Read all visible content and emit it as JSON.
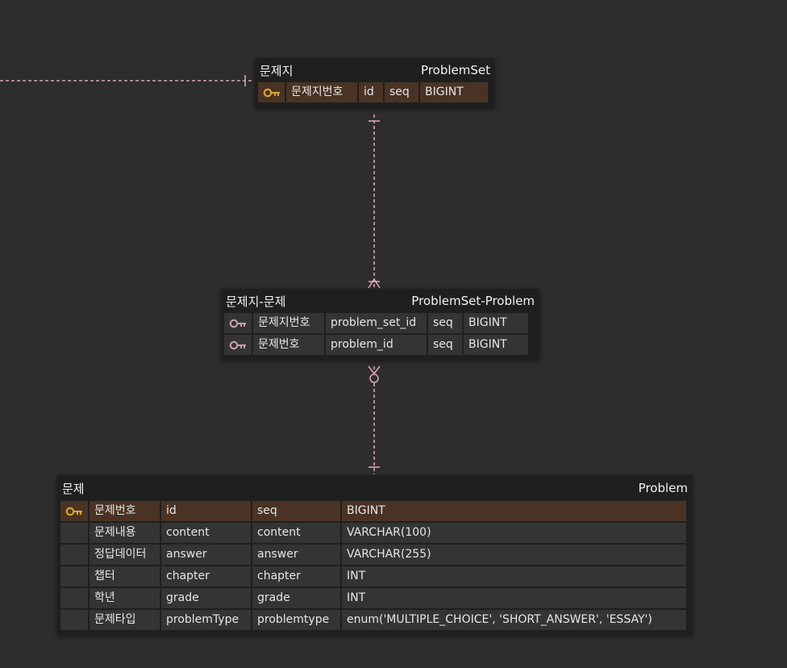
{
  "colors": {
    "background": "#2d2d2d",
    "table_body": "#1f1f1f",
    "cell": "#343434",
    "pk_row": "#4a3324",
    "edge": "#d9a3b8",
    "pk_key": "#d8a432",
    "fk_key": "#c49aa8"
  },
  "tables": {
    "problemset": {
      "logical_name": "문제지",
      "physical_name": "ProblemSet",
      "rows": [
        {
          "key": "pk-key-icon",
          "logical": "문제지번호",
          "physical": "id",
          "domain": "seq",
          "type": "BIGINT"
        }
      ]
    },
    "problemset_problem": {
      "logical_name": "문제지-문제",
      "physical_name": "ProblemSet-Problem",
      "rows": [
        {
          "key": "fk-key-icon",
          "logical": "문제지번호",
          "physical": "problem_set_id",
          "domain": "seq",
          "type": "BIGINT"
        },
        {
          "key": "fk-key-icon",
          "logical": "문제번호",
          "physical": "problem_id",
          "domain": "seq",
          "type": "BIGINT"
        }
      ]
    },
    "problem": {
      "logical_name": "문제",
      "physical_name": "Problem",
      "rows": [
        {
          "key": "pk-key-icon",
          "logical": "문제번호",
          "physical": "id",
          "domain": "seq",
          "type": "BIGINT"
        },
        {
          "key": "",
          "logical": "문제내용",
          "physical": "content",
          "domain": "content",
          "type": "VARCHAR(100)"
        },
        {
          "key": "",
          "logical": "정답데이터",
          "physical": "answer",
          "domain": "answer",
          "type": "VARCHAR(255)"
        },
        {
          "key": "",
          "logical": "챕터",
          "physical": "chapter",
          "domain": "chapter",
          "type": "INT"
        },
        {
          "key": "",
          "logical": "학년",
          "physical": "grade",
          "domain": "grade",
          "type": "INT"
        },
        {
          "key": "",
          "logical": "문제타입",
          "physical": "problemType",
          "domain": "problemtype",
          "type": "enum('MULTIPLE_CHOICE', 'SHORT_ANSWER', 'ESSAY')"
        }
      ]
    }
  }
}
